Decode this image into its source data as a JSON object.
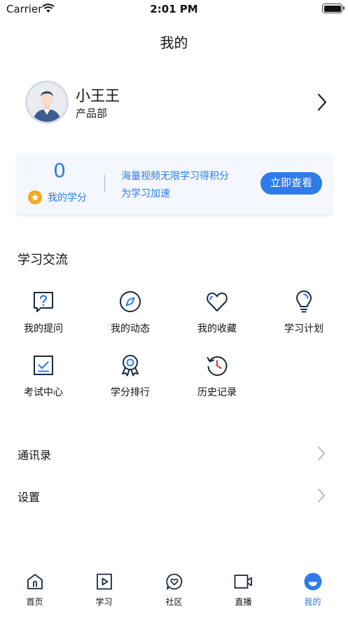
{
  "status_bar": {
    "carrier": "Carrier",
    "time": "2:01 PM"
  },
  "nav": {
    "title": "我的"
  },
  "profile": {
    "name": "小王王",
    "department": "产品部"
  },
  "score_card": {
    "score": "0",
    "score_label": "我的学分",
    "promo_line_1": "海量视频无限学习得积分",
    "promo_line_2": "为学习加速",
    "button_label": "立即查看"
  },
  "exchange": {
    "title": "学习交流",
    "items": [
      {
        "label": "我的提问",
        "icon": "question-icon"
      },
      {
        "label": "我的动态",
        "icon": "compass-icon"
      },
      {
        "label": "我的收藏",
        "icon": "heart-icon"
      },
      {
        "label": "学习计划",
        "icon": "lightbulb-icon"
      },
      {
        "label": "考试中心",
        "icon": "exam-check-icon"
      },
      {
        "label": "学分排行",
        "icon": "medal-icon"
      },
      {
        "label": "历史记录",
        "icon": "history-icon"
      }
    ]
  },
  "list": {
    "items": [
      {
        "label": "通讯录"
      },
      {
        "label": "设置"
      }
    ]
  },
  "tab_bar": {
    "active_color": "#2f7bea",
    "tabs": [
      {
        "label": "首页",
        "icon": "home-icon"
      },
      {
        "label": "学习",
        "icon": "video-play-icon"
      },
      {
        "label": "社区",
        "icon": "community-heart-icon"
      },
      {
        "label": "直播",
        "icon": "live-camera-icon"
      },
      {
        "label": "我的",
        "icon": "profile-icon",
        "active": true
      }
    ]
  }
}
